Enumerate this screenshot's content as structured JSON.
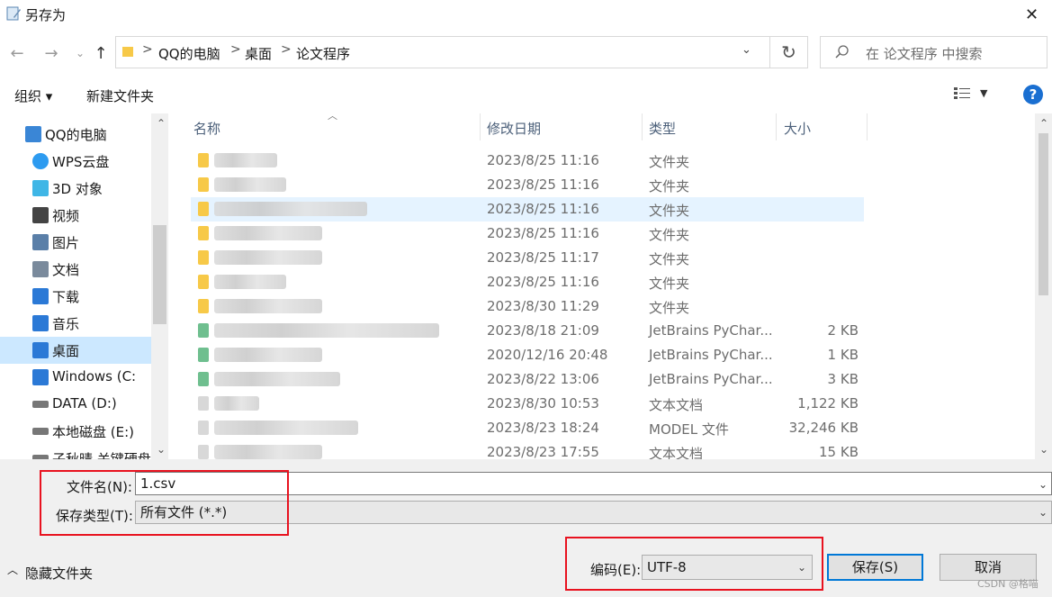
{
  "window": {
    "title": "另存为",
    "close": "✕"
  },
  "nav": {
    "breadcrumb": [
      "QQ的电脑",
      "桌面",
      "论文程序"
    ],
    "search_placeholder": "在 论文程序 中搜索"
  },
  "toolbar": {
    "organize": "组织 ▾",
    "new_folder": "新建文件夹",
    "help": "?"
  },
  "sidebar": {
    "items": [
      {
        "label": "QQ的电脑",
        "icon": "computer-icon"
      },
      {
        "label": "WPS云盘",
        "icon": "cloud-icon"
      },
      {
        "label": "3D 对象",
        "icon": "cube-icon"
      },
      {
        "label": "视频",
        "icon": "video-icon"
      },
      {
        "label": "图片",
        "icon": "picture-icon"
      },
      {
        "label": "文档",
        "icon": "document-icon"
      },
      {
        "label": "下载",
        "icon": "download-icon"
      },
      {
        "label": "音乐",
        "icon": "music-icon"
      },
      {
        "label": "桌面",
        "icon": "desktop-icon",
        "selected": true
      },
      {
        "label": "Windows (C:",
        "icon": "windows-drive-icon"
      },
      {
        "label": "DATA (D:)",
        "icon": "drive-icon"
      },
      {
        "label": "本地磁盘 (E:)",
        "icon": "drive-icon"
      },
      {
        "label": "子秋晴 关键硬盘",
        "icon": "drive-icon"
      }
    ]
  },
  "list": {
    "columns": {
      "name": "名称",
      "modified": "修改日期",
      "type": "类型",
      "size": "大小"
    },
    "rows": [
      {
        "modified": "2023/8/25 11:16",
        "type": "文件夹",
        "size": "",
        "kind": "folder",
        "blur": 70
      },
      {
        "modified": "2023/8/25 11:16",
        "type": "文件夹",
        "size": "",
        "kind": "folder",
        "blur": 80
      },
      {
        "modified": "2023/8/25 11:16",
        "type": "文件夹",
        "size": "",
        "kind": "folder",
        "blur": 170,
        "highlight": true
      },
      {
        "modified": "2023/8/25 11:16",
        "type": "文件夹",
        "size": "",
        "kind": "folder",
        "blur": 120
      },
      {
        "modified": "2023/8/25 11:17",
        "type": "文件夹",
        "size": "",
        "kind": "folder",
        "blur": 120
      },
      {
        "modified": "2023/8/25 11:16",
        "type": "文件夹",
        "size": "",
        "kind": "folder",
        "blur": 80
      },
      {
        "modified": "2023/8/30 11:29",
        "type": "文件夹",
        "size": "",
        "kind": "folder",
        "blur": 120
      },
      {
        "modified": "2023/8/18 21:09",
        "type": "JetBrains PyChar...",
        "size": "2 KB",
        "kind": "py",
        "blur": 250
      },
      {
        "modified": "2020/12/16 20:48",
        "type": "JetBrains PyChar...",
        "size": "1 KB",
        "kind": "py",
        "blur": 120
      },
      {
        "modified": "2023/8/22 13:06",
        "type": "JetBrains PyChar...",
        "size": "3 KB",
        "kind": "py",
        "blur": 140
      },
      {
        "modified": "2023/8/30 10:53",
        "type": "文本文档",
        "size": "1,122 KB",
        "kind": "txt",
        "blur": 50
      },
      {
        "modified": "2023/8/23 18:24",
        "type": "MODEL 文件",
        "size": "32,246 KB",
        "kind": "file",
        "blur": 160
      },
      {
        "modified": "2023/8/23 17:55",
        "type": "文本文档",
        "size": "15 KB",
        "kind": "txt",
        "blur": 120
      }
    ]
  },
  "form": {
    "filename_label": "文件名(N):",
    "filename_value": "1.csv",
    "type_label": "保存类型(T):",
    "type_value": "所有文件  (*.*)",
    "hide_folders": "隐藏文件夹",
    "encoding_label": "编码(E):",
    "encoding_value": "UTF-8",
    "save": "保存(S)",
    "cancel": "取消"
  },
  "watermark": "CSDN @格喵",
  "colors": {
    "accent": "#0078d7",
    "highlight": "#e5f3ff",
    "selected": "#cce8ff",
    "annotation": "#e8121f"
  }
}
